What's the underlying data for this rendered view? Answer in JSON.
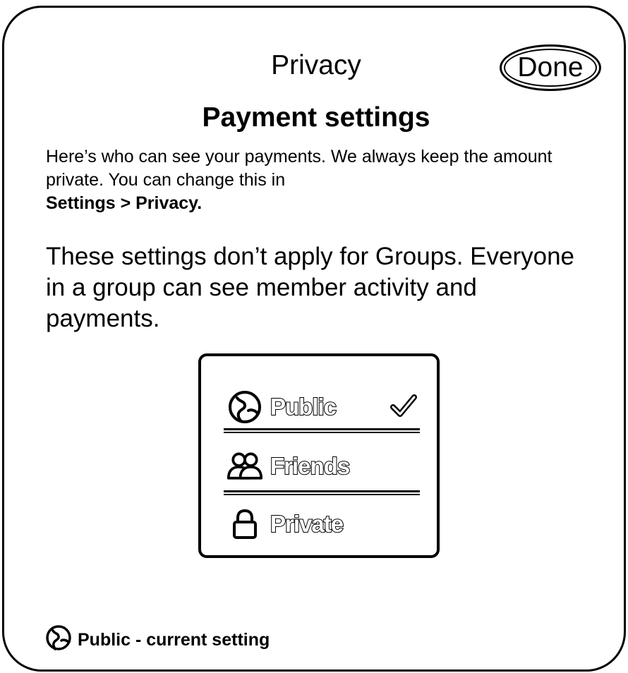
{
  "header": {
    "title": "Privacy",
    "done_label": "Done"
  },
  "page_title": "Payment settings",
  "description": {
    "text": "Here’s who can see your payments. We always keep the amount private. You can change this in",
    "path": "Settings > Privacy."
  },
  "groups_note": "These settings don’t apply for Groups. Everyone in a group can see member activity and payments.",
  "options": [
    {
      "label": "Public",
      "icon": "globe-icon",
      "selected": true
    },
    {
      "label": "Friends",
      "icon": "friends-icon",
      "selected": false
    },
    {
      "label": "Private",
      "icon": "lock-icon",
      "selected": false
    }
  ],
  "current_setting": {
    "icon": "globe-icon",
    "text": "Public - current setting"
  }
}
